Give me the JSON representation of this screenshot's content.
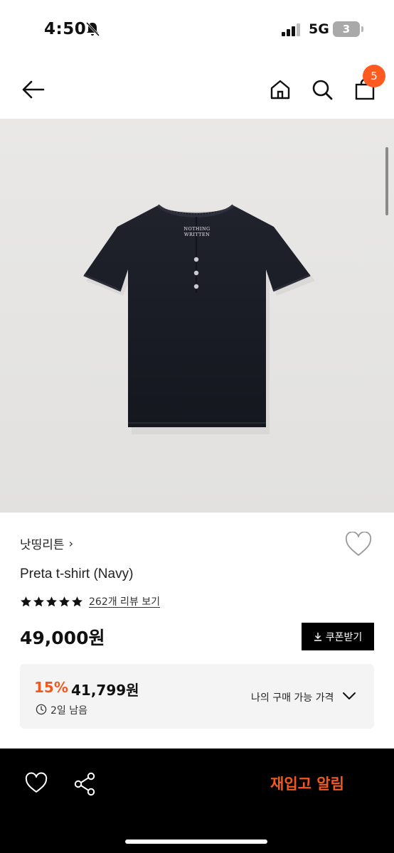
{
  "status_bar": {
    "time": "4:50",
    "network": "5G",
    "battery": "3",
    "icons": [
      "bell-slash-icon",
      "signal-icon"
    ]
  },
  "nav": {
    "icons": [
      "back-arrow-icon",
      "home-icon",
      "search-icon",
      "shopping-bag-icon"
    ],
    "cart_count": "5"
  },
  "product": {
    "brand": "낫띵리튼",
    "brand_chevron": "›",
    "name": "Preta t-shirt (Navy)",
    "rating_stars": 5,
    "review_link": "262개 리뷰 보기",
    "price": "49,000원",
    "coupon_label": "쿠폰받기",
    "image_label_line1": "NOTHING",
    "image_label_line2": "WRITTEN"
  },
  "benefit": {
    "discount_rate": "15%",
    "discount_price": "41,799원",
    "time_left": "2일 남음",
    "my_price_label": "나의 구매 가능 가격"
  },
  "bottom_bar": {
    "restock_label": "재입고 알림",
    "icons": [
      "heart-outline-icon",
      "share-icon"
    ]
  },
  "colors": {
    "accent": "#f2581e",
    "badge": "#ff5a1f",
    "card_bg": "#f4f4f4",
    "garment": "#1b1d26"
  }
}
